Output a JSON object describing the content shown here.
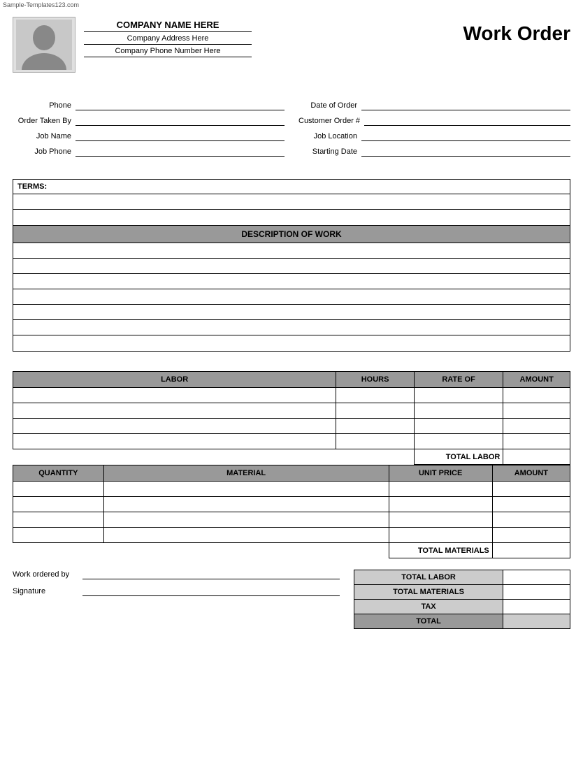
{
  "watermark": "Sample-Templates123.com",
  "header": {
    "company_name": "COMPANY NAME HERE",
    "company_address": "Company Address Here",
    "company_phone": "Company Phone Number Here",
    "title": "Work Order"
  },
  "form": {
    "left": [
      {
        "label": "Phone",
        "value": ""
      },
      {
        "label": "Order Taken By",
        "value": ""
      },
      {
        "label": "Job Name",
        "value": ""
      },
      {
        "label": "Job Phone",
        "value": ""
      }
    ],
    "right": [
      {
        "label": "Date of Order",
        "value": ""
      },
      {
        "label": "Customer Order #",
        "value": ""
      },
      {
        "label": "Job Location",
        "value": ""
      },
      {
        "label": "Starting Date",
        "value": ""
      }
    ]
  },
  "terms": {
    "label": "TERMS:",
    "rows": 3
  },
  "description": {
    "header": "DESCRIPTION OF WORK",
    "rows": 7
  },
  "labor": {
    "columns": [
      "LABOR",
      "HOURS",
      "RATE OF",
      "AMOUNT"
    ],
    "rows": 4,
    "total_label": "TOTAL LABOR"
  },
  "materials": {
    "columns": [
      "QUANTITY",
      "MATERIAL",
      "UNIT PRICE",
      "AMOUNT"
    ],
    "rows": 4,
    "total_label": "TOTAL MATERIALS"
  },
  "summary": {
    "rows": [
      {
        "label": "TOTAL LABOR",
        "dark": false
      },
      {
        "label": "TOTAL MATERIALS",
        "dark": false
      },
      {
        "label": "TAX",
        "dark": false
      },
      {
        "label": "TOTAL",
        "dark": true
      }
    ]
  },
  "signature": {
    "work_ordered_by": "Work ordered by",
    "signature": "Signature"
  }
}
